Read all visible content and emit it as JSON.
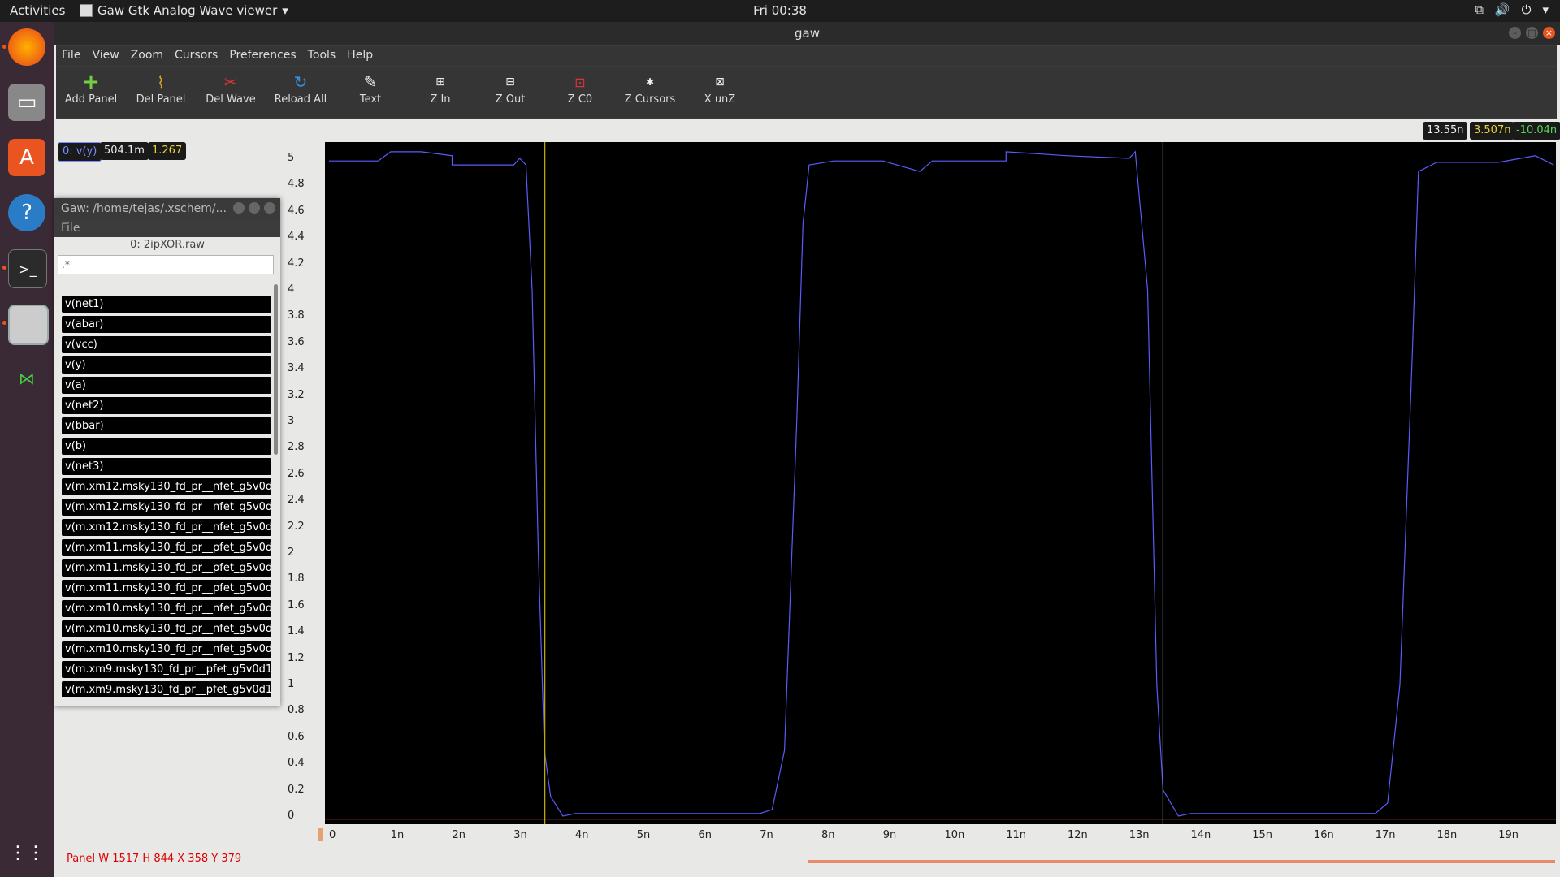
{
  "topbar": {
    "activities": "Activities",
    "app_menu": "Gaw Gtk Analog Wave viewer",
    "clock": "Fri 00:38"
  },
  "window": {
    "title": "gaw"
  },
  "menubar": [
    "File",
    "View",
    "Zoom",
    "Cursors",
    "Preferences",
    "Tools",
    "Help"
  ],
  "toolbar": [
    {
      "label": "Add Panel",
      "icon": "plus-icon"
    },
    {
      "label": "Del Panel",
      "icon": "broom-icon"
    },
    {
      "label": "Del Wave",
      "icon": "scissors-icon"
    },
    {
      "label": "Reload All",
      "icon": "reload-icon"
    },
    {
      "label": "Text",
      "icon": "text-icon"
    },
    {
      "label": "Z In",
      "icon": "zoom-in-icon"
    },
    {
      "label": "Z Out",
      "icon": "zoom-out-icon"
    },
    {
      "label": "Z C0",
      "icon": "zoom-cursor0-icon"
    },
    {
      "label": "Z Cursors",
      "icon": "zoom-cursors-icon"
    },
    {
      "label": "X unZ",
      "icon": "x-unzoom-icon"
    }
  ],
  "cursor_readout": {
    "c0": "13.55n",
    "c1": "3.507n",
    "delta": "-10.04n"
  },
  "wave_readout": {
    "name": "0: v(y)",
    "value": "504.1m",
    "value2": "1.267"
  },
  "y_axis": [
    "5",
    "4.8",
    "4.6",
    "4.4",
    "4.2",
    "4",
    "3.8",
    "3.6",
    "3.4",
    "3.2",
    "3",
    "2.8",
    "2.6",
    "2.4",
    "2.2",
    "2",
    "1.8",
    "1.6",
    "1.4",
    "1.2",
    "1",
    "0.8",
    "0.6",
    "0.4",
    "0.2",
    "0"
  ],
  "x_axis": [
    "0",
    "1n",
    "2n",
    "3n",
    "4n",
    "5n",
    "6n",
    "7n",
    "8n",
    "9n",
    "10n",
    "11n",
    "12n",
    "13n",
    "14n",
    "15n",
    "16n",
    "17n",
    "18n",
    "19n"
  ],
  "status": "Panel W 1517 H 844 X 358 Y 379",
  "dialog": {
    "title": "Gaw: /home/tejas/.xschem/...",
    "menu": "File",
    "file": "0: 2ipXOR.raw",
    "filter": ".*",
    "waves": [
      "v(net1)",
      "v(abar)",
      "v(vcc)",
      "v(y)",
      "v(a)",
      "v(net2)",
      "v(bbar)",
      "v(b)",
      "v(net3)",
      "v(m.xm12.msky130_fd_pr__nfet_g5v0d",
      "v(m.xm12.msky130_fd_pr__nfet_g5v0d",
      "v(m.xm12.msky130_fd_pr__nfet_g5v0d",
      "v(m.xm11.msky130_fd_pr__pfet_g5v0d",
      "v(m.xm11.msky130_fd_pr__pfet_g5v0d",
      "v(m.xm11.msky130_fd_pr__pfet_g5v0d",
      "v(m.xm10.msky130_fd_pr__nfet_g5v0d",
      "v(m.xm10.msky130_fd_pr__nfet_g5v0d",
      "v(m.xm10.msky130_fd_pr__nfet_g5v0d",
      "v(m.xm9.msky130_fd_pr__pfet_g5v0d1",
      "v(m.xm9.msky130_fd_pr__pfet_g5v0d1"
    ]
  },
  "colors": {
    "wave": "#5b5bff",
    "cursor0": "#c8b400",
    "cursor1": "#bbbbbb",
    "accent": "#e95420"
  }
}
